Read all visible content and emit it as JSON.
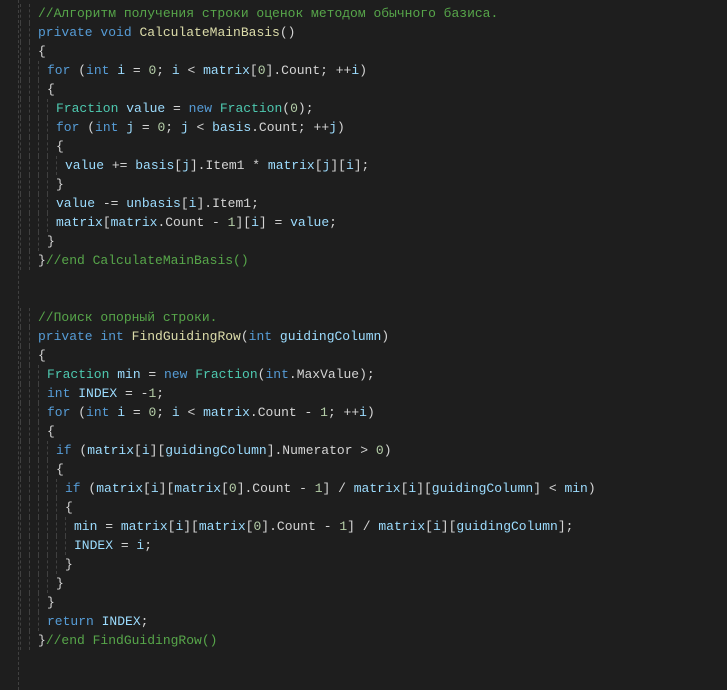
{
  "lines": [
    {
      "indent": 2,
      "tokens": [
        {
          "cls": "comment",
          "t": "//Алгоритм получения строки оценок методом обычного базиса."
        }
      ]
    },
    {
      "indent": 2,
      "tokens": [
        {
          "cls": "keyword",
          "t": "private "
        },
        {
          "cls": "keyword",
          "t": "void "
        },
        {
          "cls": "method",
          "t": "CalculateMainBasis"
        },
        {
          "cls": "plain",
          "t": "()"
        }
      ]
    },
    {
      "indent": 2,
      "tokens": [
        {
          "cls": "plain",
          "t": "{"
        }
      ]
    },
    {
      "indent": 3,
      "tokens": [
        {
          "cls": "keyword",
          "t": "for "
        },
        {
          "cls": "plain",
          "t": "("
        },
        {
          "cls": "keyword",
          "t": "int "
        },
        {
          "cls": "identifier",
          "t": "i"
        },
        {
          "cls": "plain",
          "t": " = "
        },
        {
          "cls": "number",
          "t": "0"
        },
        {
          "cls": "plain",
          "t": "; "
        },
        {
          "cls": "identifier",
          "t": "i"
        },
        {
          "cls": "plain",
          "t": " < "
        },
        {
          "cls": "identifier",
          "t": "matrix"
        },
        {
          "cls": "plain",
          "t": "["
        },
        {
          "cls": "number",
          "t": "0"
        },
        {
          "cls": "plain",
          "t": "].Count; ++"
        },
        {
          "cls": "identifier",
          "t": "i"
        },
        {
          "cls": "plain",
          "t": ")"
        }
      ]
    },
    {
      "indent": 3,
      "tokens": [
        {
          "cls": "plain",
          "t": "{"
        }
      ]
    },
    {
      "indent": 4,
      "tokens": [
        {
          "cls": "type",
          "t": "Fraction "
        },
        {
          "cls": "identifier",
          "t": "value"
        },
        {
          "cls": "plain",
          "t": " = "
        },
        {
          "cls": "keyword",
          "t": "new "
        },
        {
          "cls": "type",
          "t": "Fraction"
        },
        {
          "cls": "plain",
          "t": "("
        },
        {
          "cls": "number",
          "t": "0"
        },
        {
          "cls": "plain",
          "t": ");"
        }
      ]
    },
    {
      "indent": 4,
      "tokens": [
        {
          "cls": "keyword",
          "t": "for "
        },
        {
          "cls": "plain",
          "t": "("
        },
        {
          "cls": "keyword",
          "t": "int "
        },
        {
          "cls": "identifier",
          "t": "j"
        },
        {
          "cls": "plain",
          "t": " = "
        },
        {
          "cls": "number",
          "t": "0"
        },
        {
          "cls": "plain",
          "t": "; "
        },
        {
          "cls": "identifier",
          "t": "j"
        },
        {
          "cls": "plain",
          "t": " < "
        },
        {
          "cls": "identifier",
          "t": "basis"
        },
        {
          "cls": "plain",
          "t": ".Count; ++"
        },
        {
          "cls": "identifier",
          "t": "j"
        },
        {
          "cls": "plain",
          "t": ")"
        }
      ]
    },
    {
      "indent": 4,
      "tokens": [
        {
          "cls": "plain",
          "t": "{"
        }
      ]
    },
    {
      "indent": 5,
      "tokens": [
        {
          "cls": "identifier",
          "t": "value"
        },
        {
          "cls": "plain",
          "t": " += "
        },
        {
          "cls": "identifier",
          "t": "basis"
        },
        {
          "cls": "plain",
          "t": "["
        },
        {
          "cls": "identifier",
          "t": "j"
        },
        {
          "cls": "plain",
          "t": "].Item1 * "
        },
        {
          "cls": "identifier",
          "t": "matrix"
        },
        {
          "cls": "plain",
          "t": "["
        },
        {
          "cls": "identifier",
          "t": "j"
        },
        {
          "cls": "plain",
          "t": "]["
        },
        {
          "cls": "identifier",
          "t": "i"
        },
        {
          "cls": "plain",
          "t": "];"
        }
      ]
    },
    {
      "indent": 4,
      "tokens": [
        {
          "cls": "plain",
          "t": "}"
        }
      ]
    },
    {
      "indent": 4,
      "tokens": [
        {
          "cls": "identifier",
          "t": "value"
        },
        {
          "cls": "plain",
          "t": " -= "
        },
        {
          "cls": "identifier",
          "t": "unbasis"
        },
        {
          "cls": "plain",
          "t": "["
        },
        {
          "cls": "identifier",
          "t": "i"
        },
        {
          "cls": "plain",
          "t": "].Item1;"
        }
      ]
    },
    {
      "indent": 4,
      "tokens": [
        {
          "cls": "identifier",
          "t": "matrix"
        },
        {
          "cls": "plain",
          "t": "["
        },
        {
          "cls": "identifier",
          "t": "matrix"
        },
        {
          "cls": "plain",
          "t": ".Count - "
        },
        {
          "cls": "number",
          "t": "1"
        },
        {
          "cls": "plain",
          "t": "]["
        },
        {
          "cls": "identifier",
          "t": "i"
        },
        {
          "cls": "plain",
          "t": "] = "
        },
        {
          "cls": "identifier",
          "t": "value"
        },
        {
          "cls": "plain",
          "t": ";"
        }
      ]
    },
    {
      "indent": 3,
      "tokens": [
        {
          "cls": "plain",
          "t": "}"
        }
      ]
    },
    {
      "indent": 2,
      "tokens": [
        {
          "cls": "plain",
          "t": "}"
        },
        {
          "cls": "comment",
          "t": "//end CalculateMainBasis()"
        }
      ]
    },
    {
      "indent": 0,
      "tokens": []
    },
    {
      "indent": 0,
      "tokens": []
    },
    {
      "indent": 2,
      "tokens": [
        {
          "cls": "comment",
          "t": "//Поиск опорный строки."
        }
      ]
    },
    {
      "indent": 2,
      "tokens": [
        {
          "cls": "keyword",
          "t": "private "
        },
        {
          "cls": "keyword",
          "t": "int "
        },
        {
          "cls": "method",
          "t": "FindGuidingRow"
        },
        {
          "cls": "plain",
          "t": "("
        },
        {
          "cls": "keyword",
          "t": "int "
        },
        {
          "cls": "identifier",
          "t": "guidingColumn"
        },
        {
          "cls": "plain",
          "t": ")"
        }
      ]
    },
    {
      "indent": 2,
      "tokens": [
        {
          "cls": "plain",
          "t": "{"
        }
      ]
    },
    {
      "indent": 3,
      "tokens": [
        {
          "cls": "type",
          "t": "Fraction "
        },
        {
          "cls": "identifier",
          "t": "min"
        },
        {
          "cls": "plain",
          "t": " = "
        },
        {
          "cls": "keyword",
          "t": "new "
        },
        {
          "cls": "type",
          "t": "Fraction"
        },
        {
          "cls": "plain",
          "t": "("
        },
        {
          "cls": "keyword",
          "t": "int"
        },
        {
          "cls": "plain",
          "t": ".MaxValue);"
        }
      ]
    },
    {
      "indent": 3,
      "tokens": [
        {
          "cls": "keyword",
          "t": "int "
        },
        {
          "cls": "identifier",
          "t": "INDEX"
        },
        {
          "cls": "plain",
          "t": " = -"
        },
        {
          "cls": "number",
          "t": "1"
        },
        {
          "cls": "plain",
          "t": ";"
        }
      ]
    },
    {
      "indent": 3,
      "tokens": [
        {
          "cls": "keyword",
          "t": "for "
        },
        {
          "cls": "plain",
          "t": "("
        },
        {
          "cls": "keyword",
          "t": "int "
        },
        {
          "cls": "identifier",
          "t": "i"
        },
        {
          "cls": "plain",
          "t": " = "
        },
        {
          "cls": "number",
          "t": "0"
        },
        {
          "cls": "plain",
          "t": "; "
        },
        {
          "cls": "identifier",
          "t": "i"
        },
        {
          "cls": "plain",
          "t": " < "
        },
        {
          "cls": "identifier",
          "t": "matrix"
        },
        {
          "cls": "plain",
          "t": ".Count - "
        },
        {
          "cls": "number",
          "t": "1"
        },
        {
          "cls": "plain",
          "t": "; ++"
        },
        {
          "cls": "identifier",
          "t": "i"
        },
        {
          "cls": "plain",
          "t": ")"
        }
      ]
    },
    {
      "indent": 3,
      "tokens": [
        {
          "cls": "plain",
          "t": "{"
        }
      ]
    },
    {
      "indent": 4,
      "tokens": [
        {
          "cls": "keyword",
          "t": "if "
        },
        {
          "cls": "plain",
          "t": "("
        },
        {
          "cls": "identifier",
          "t": "matrix"
        },
        {
          "cls": "plain",
          "t": "["
        },
        {
          "cls": "identifier",
          "t": "i"
        },
        {
          "cls": "plain",
          "t": "]["
        },
        {
          "cls": "identifier",
          "t": "guidingColumn"
        },
        {
          "cls": "plain",
          "t": "].Numerator > "
        },
        {
          "cls": "number",
          "t": "0"
        },
        {
          "cls": "plain",
          "t": ")"
        }
      ]
    },
    {
      "indent": 4,
      "tokens": [
        {
          "cls": "plain",
          "t": "{"
        }
      ]
    },
    {
      "indent": 5,
      "tokens": [
        {
          "cls": "keyword",
          "t": "if "
        },
        {
          "cls": "plain",
          "t": "("
        },
        {
          "cls": "identifier",
          "t": "matrix"
        },
        {
          "cls": "plain",
          "t": "["
        },
        {
          "cls": "identifier",
          "t": "i"
        },
        {
          "cls": "plain",
          "t": "]["
        },
        {
          "cls": "identifier",
          "t": "matrix"
        },
        {
          "cls": "plain",
          "t": "["
        },
        {
          "cls": "number",
          "t": "0"
        },
        {
          "cls": "plain",
          "t": "].Count - "
        },
        {
          "cls": "number",
          "t": "1"
        },
        {
          "cls": "plain",
          "t": "] / "
        },
        {
          "cls": "identifier",
          "t": "matrix"
        },
        {
          "cls": "plain",
          "t": "["
        },
        {
          "cls": "identifier",
          "t": "i"
        },
        {
          "cls": "plain",
          "t": "]["
        },
        {
          "cls": "identifier",
          "t": "guidingColumn"
        },
        {
          "cls": "plain",
          "t": "] < "
        },
        {
          "cls": "identifier",
          "t": "min"
        },
        {
          "cls": "plain",
          "t": ")"
        }
      ]
    },
    {
      "indent": 5,
      "tokens": [
        {
          "cls": "plain",
          "t": "{"
        }
      ]
    },
    {
      "indent": 6,
      "tokens": [
        {
          "cls": "identifier",
          "t": "min"
        },
        {
          "cls": "plain",
          "t": " = "
        },
        {
          "cls": "identifier",
          "t": "matrix"
        },
        {
          "cls": "plain",
          "t": "["
        },
        {
          "cls": "identifier",
          "t": "i"
        },
        {
          "cls": "plain",
          "t": "]["
        },
        {
          "cls": "identifier",
          "t": "matrix"
        },
        {
          "cls": "plain",
          "t": "["
        },
        {
          "cls": "number",
          "t": "0"
        },
        {
          "cls": "plain",
          "t": "].Count - "
        },
        {
          "cls": "number",
          "t": "1"
        },
        {
          "cls": "plain",
          "t": "] / "
        },
        {
          "cls": "identifier",
          "t": "matrix"
        },
        {
          "cls": "plain",
          "t": "["
        },
        {
          "cls": "identifier",
          "t": "i"
        },
        {
          "cls": "plain",
          "t": "]["
        },
        {
          "cls": "identifier",
          "t": "guidingColumn"
        },
        {
          "cls": "plain",
          "t": "];"
        }
      ]
    },
    {
      "indent": 6,
      "tokens": [
        {
          "cls": "identifier",
          "t": "INDEX"
        },
        {
          "cls": "plain",
          "t": " = "
        },
        {
          "cls": "identifier",
          "t": "i"
        },
        {
          "cls": "plain",
          "t": ";"
        }
      ]
    },
    {
      "indent": 5,
      "tokens": [
        {
          "cls": "plain",
          "t": "}"
        }
      ]
    },
    {
      "indent": 4,
      "tokens": [
        {
          "cls": "plain",
          "t": "}"
        }
      ]
    },
    {
      "indent": 3,
      "tokens": [
        {
          "cls": "plain",
          "t": "}"
        }
      ]
    },
    {
      "indent": 3,
      "tokens": [
        {
          "cls": "keyword",
          "t": "return "
        },
        {
          "cls": "identifier",
          "t": "INDEX"
        },
        {
          "cls": "plain",
          "t": ";"
        }
      ]
    },
    {
      "indent": 2,
      "tokens": [
        {
          "cls": "plain",
          "t": "}"
        },
        {
          "cls": "comment",
          "t": "//end FindGuidingRow()"
        }
      ]
    }
  ]
}
